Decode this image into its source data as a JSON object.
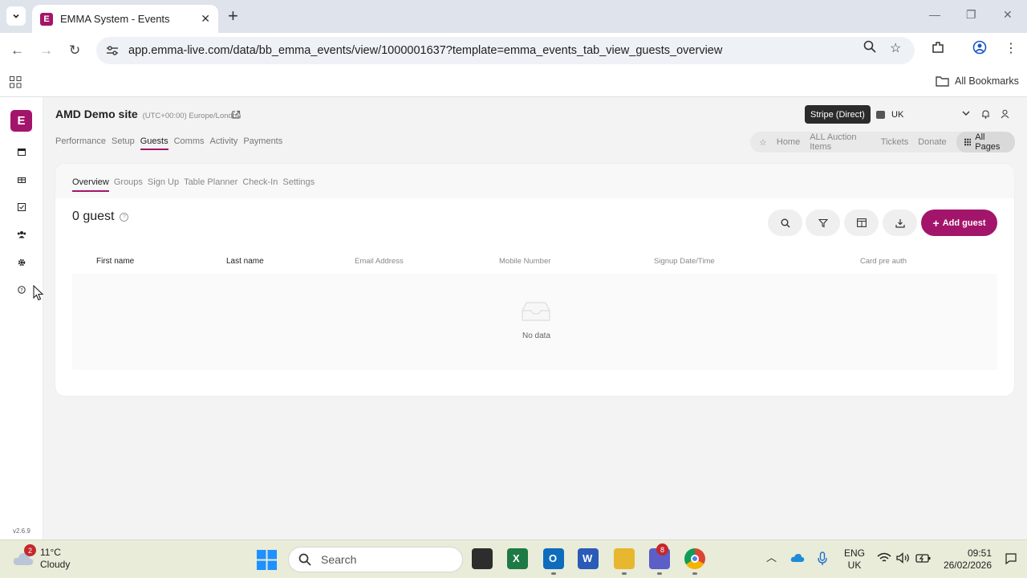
{
  "browser": {
    "tab_title": "EMMA System - Events",
    "url": "app.emma-live.com/data/bb_emma_events/view/1000001637?template=emma_events_tab_view_guests_overview",
    "bookmarks_label": "All Bookmarks"
  },
  "sidebar": {
    "logo": "E",
    "version": "v2.6.9"
  },
  "header": {
    "site_name": "AMD Demo site",
    "timezone": "(UTC+00:00) Europe/London",
    "payment_badge": "Stripe (Direct)",
    "region": "UK"
  },
  "main_nav": [
    "Performance",
    "Setup",
    "Guests",
    "Comms",
    "Activity",
    "Payments"
  ],
  "quick_links": [
    "Home",
    "ALL Auction Items",
    "Tickets",
    "Donate"
  ],
  "all_pages_label": "All Pages",
  "sub_tabs": [
    "Overview",
    "Groups",
    "Sign Up",
    "Table Planner",
    "Check-In",
    "Settings"
  ],
  "guests": {
    "count_label": "0 guest",
    "add_label": "Add guest",
    "columns": [
      "First name",
      "Last name",
      "Email Address",
      "Mobile Number",
      "Signup Date/Time",
      "Card pre auth"
    ],
    "empty_text": "No data"
  },
  "taskbar": {
    "weather_badge": "2",
    "temperature": "11°C",
    "condition": "Cloudy",
    "search_placeholder": "Search",
    "teams_badge": "8",
    "lang_line1": "ENG",
    "lang_line2": "UK",
    "time": "09:51",
    "date": "26/02/2026"
  },
  "colors": {
    "brand": "#a3156b"
  }
}
